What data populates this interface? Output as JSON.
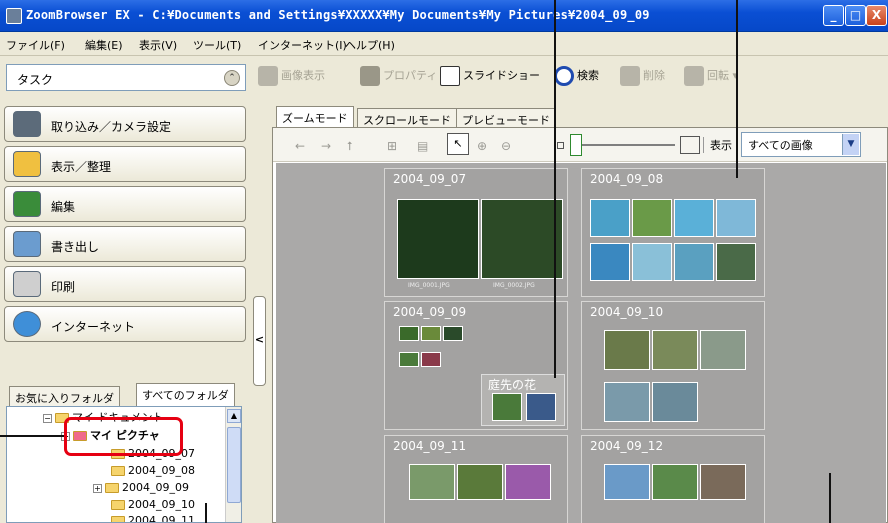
{
  "window": {
    "title": "ZoomBrowser EX  -  C:¥Documents and Settings¥XXXXX¥My Documents¥My Pictures¥2004_09_09",
    "minimize": "_",
    "maximize": "□",
    "close": "X"
  },
  "menu": [
    "ファイル(F)",
    "編集(E)",
    "表示(V)",
    "ツール(T)",
    "インターネット(I)",
    "ヘルプ(H)"
  ],
  "task": {
    "label": "タスク",
    "collapse": "⌃"
  },
  "toolbar": {
    "view_image": "画像表示",
    "properties": "プロパティ",
    "slideshow": "スライドショー",
    "search": "検索",
    "delete": "削除",
    "rotate": "回転"
  },
  "tasks": [
    "取り込み／カメラ設定",
    "表示／整理",
    "編集",
    "書き出し",
    "印刷",
    "インターネット"
  ],
  "splitter_arrow": "<",
  "folder_tabs": [
    "お気に入りフォルダ",
    "すべてのフォルダ"
  ],
  "tree": {
    "items": [
      "マイ ドキュメント",
      "マイ ピクチャ",
      "2004_09_07",
      "2004_09_08",
      "2004_09_09",
      "2004_09_10",
      "2004_09_11"
    ],
    "expand_minus": "−",
    "expand_plus": "+",
    "scroll_up": "▲"
  },
  "mode_tabs": [
    "ズームモード",
    "スクロールモード",
    "プレビューモード"
  ],
  "view_toolbar": {
    "pointer": "↖",
    "display_label": "表示",
    "filter_value": "すべての画像",
    "filter_arrow": "▼",
    "icons": [
      "←",
      "→",
      "⭡",
      "⊞",
      "▤",
      "⊕",
      "⊖"
    ]
  },
  "groups": [
    {
      "title": "2004_09_07",
      "captions": [
        "IMG_0001.JPG",
        "IMG_0002.JPG"
      ]
    },
    {
      "title": "2004_09_08"
    },
    {
      "title": "2004_09_09",
      "subgroup": "庭先の花"
    },
    {
      "title": "2004_09_10"
    },
    {
      "title": "2004_09_11"
    },
    {
      "title": "2004_09_12"
    }
  ],
  "colors": {
    "titlebar": "#0a4fd4",
    "callout": "#e60012",
    "gallery_bg": "#aaa9a8"
  }
}
